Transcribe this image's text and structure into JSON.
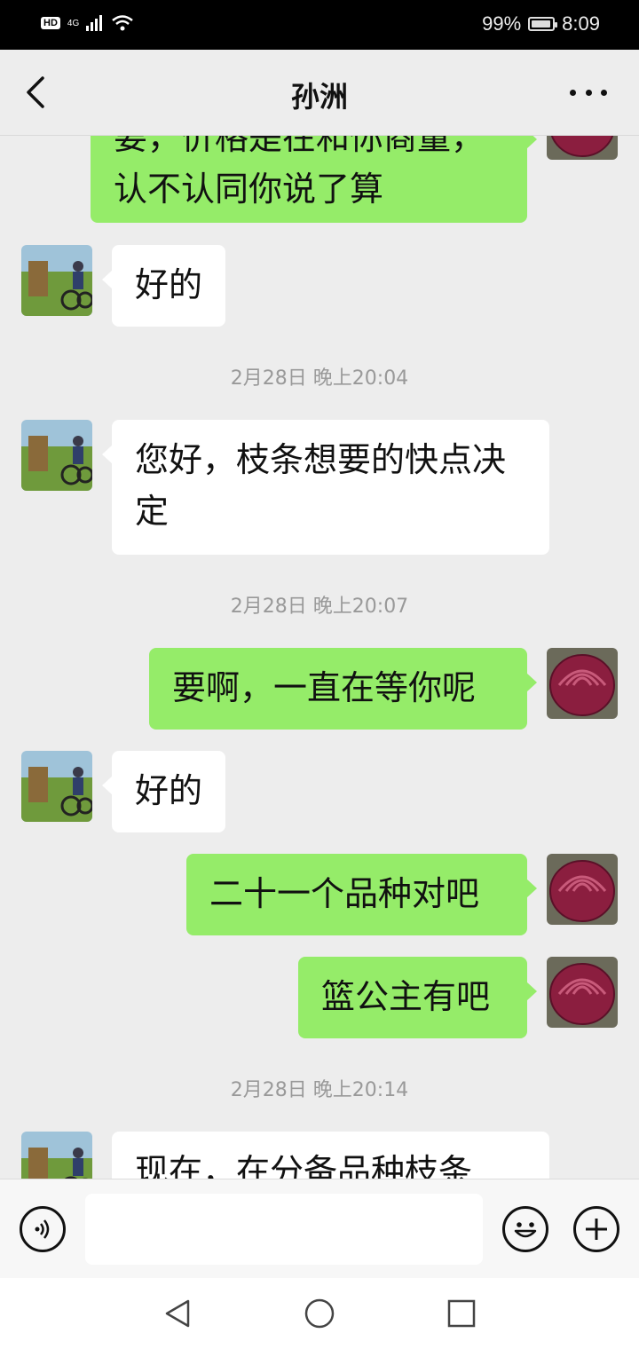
{
  "status": {
    "network": "4G",
    "battery": "99%",
    "time": "8:09"
  },
  "header": {
    "title": "孙洲"
  },
  "messages": {
    "m0": "要，价格是在和你商量，认不认同你说了算",
    "m1": "好的",
    "t1": "2月28日 晚上20:04",
    "m2": "您好，枝条想要的快点决定",
    "t2": "2月28日 晚上20:07",
    "m3": "要啊，一直在等你呢",
    "m4": "好的",
    "m5": "二十一个品种对吧",
    "m6": "篮公主有吧",
    "t3": "2月28日 晚上20:14",
    "m7": "现在，在分备品种枝条"
  },
  "input": {
    "value": ""
  },
  "icons": [
    "back-arrow-icon",
    "more-icon",
    "voice-icon",
    "emoji-icon",
    "plus-icon",
    "nav-back-icon",
    "nav-home-icon",
    "nav-recent-icon"
  ],
  "colors": {
    "outgoing": "#95ec69",
    "incoming": "#ffffff",
    "background": "#ededed"
  }
}
